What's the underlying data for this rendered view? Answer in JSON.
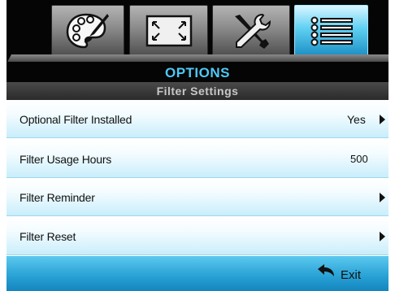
{
  "menu": {
    "tabs": [
      {
        "icon": "palette-icon",
        "active": false
      },
      {
        "icon": "screen-resize-icon",
        "active": false
      },
      {
        "icon": "tools-icon",
        "active": false
      },
      {
        "icon": "options-list-icon",
        "active": true
      }
    ],
    "title": "OPTIONS",
    "subtitle": "Filter Settings"
  },
  "items": [
    {
      "label": "Optional Filter Installed",
      "value": "Yes",
      "has_arrow": true
    },
    {
      "label": "Filter Usage Hours",
      "value": "500",
      "has_arrow": false
    },
    {
      "label": "Filter Reminder",
      "value": "",
      "has_arrow": true
    },
    {
      "label": "Filter Reset",
      "value": "",
      "has_arrow": true
    }
  ],
  "footer": {
    "exit_label": "Exit",
    "exit_icon": "return-arrow-icon"
  },
  "colors": {
    "accent": "#4fc8f5",
    "row_gradient_end": "#c9eefb",
    "footer": "#2aa3d6",
    "background": "#050505"
  }
}
